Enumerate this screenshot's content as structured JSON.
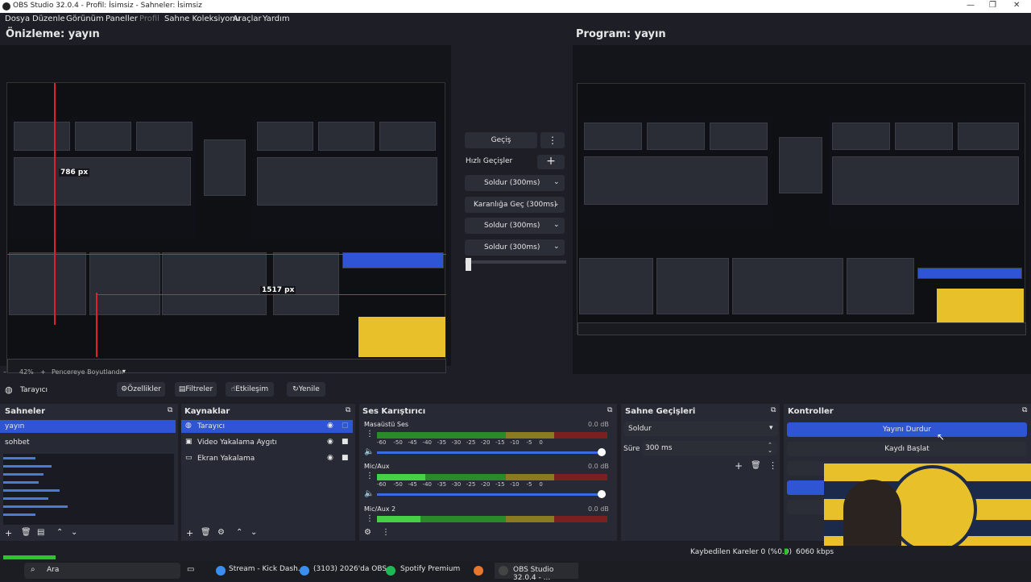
{
  "window": {
    "title": "OBS Studio 32.0.4 - Profil: İsimsiz - Sahneler: İsimsiz"
  },
  "menu": {
    "items": [
      "Dosya",
      "Düzenle",
      "Görünüm",
      "Paneller",
      "Profil",
      "Sahne Koleksiyonu",
      "Araçlar",
      "Yardım"
    ]
  },
  "preview": {
    "label": "Önizleme: yayın",
    "measure_h": "786 px",
    "measure_w": "1517 px",
    "zoom": "42%",
    "fit_mode": "Pencereye Boyutlandır"
  },
  "program": {
    "label": "Program: yayın"
  },
  "transitions_center": {
    "transition_button": "Geçiş",
    "quick_label": "Hızlı Geçişler",
    "items": [
      "Soldur (300ms)",
      "Karanlığa Geç (300ms)",
      "Soldur (300ms)",
      "Soldur (300ms)"
    ]
  },
  "source_toolbar": {
    "selected_source": "Tarayıcı",
    "properties": "Özellikler",
    "filters": "Filtreler",
    "interact": "Etkileşim",
    "refresh": "Yenile"
  },
  "scenes": {
    "title": "Sahneler",
    "items": [
      "yayın",
      "sohbet"
    ]
  },
  "sources": {
    "title": "Kaynaklar",
    "items": [
      "Tarayıcı",
      "Video Yakalama Aygıtı",
      "Ekran Yakalama"
    ]
  },
  "mixer": {
    "title": "Ses Karıştırıcı",
    "channels": [
      {
        "name": "Masaüstü Ses",
        "db": "0.0 dB"
      },
      {
        "name": "Mic/Aux",
        "db": "0.0 dB"
      },
      {
        "name": "Mic/Aux 2",
        "db": "0.0 dB"
      }
    ],
    "ticks": [
      "-60",
      "-50",
      "-45",
      "-40",
      "-35",
      "-30",
      "-25",
      "-20",
      "-15",
      "-10",
      "-5",
      "0"
    ]
  },
  "scene_transitions": {
    "title": "Sahne Geçişleri",
    "selected": "Soldur",
    "duration_label": "Süre",
    "duration_value": "300 ms"
  },
  "controls": {
    "title": "Kontroller",
    "stop_stream": "Yayını Durdur",
    "start_record": "Kaydı Başlat"
  },
  "status": {
    "dropped": "Kaybedilen Kareler 0 (%0.0)",
    "bitrate": "6060 kbps"
  },
  "taskbar": {
    "search": "Ara",
    "items": [
      "Stream - Kick Dash...",
      "(3103) 2026'da OBS ...",
      "Spotify Premium",
      "OBS Studio 32.0.4 - ..."
    ]
  },
  "colors": {
    "accent": "#2f55d4",
    "background": "#1e1f26",
    "panel": "#272934"
  }
}
